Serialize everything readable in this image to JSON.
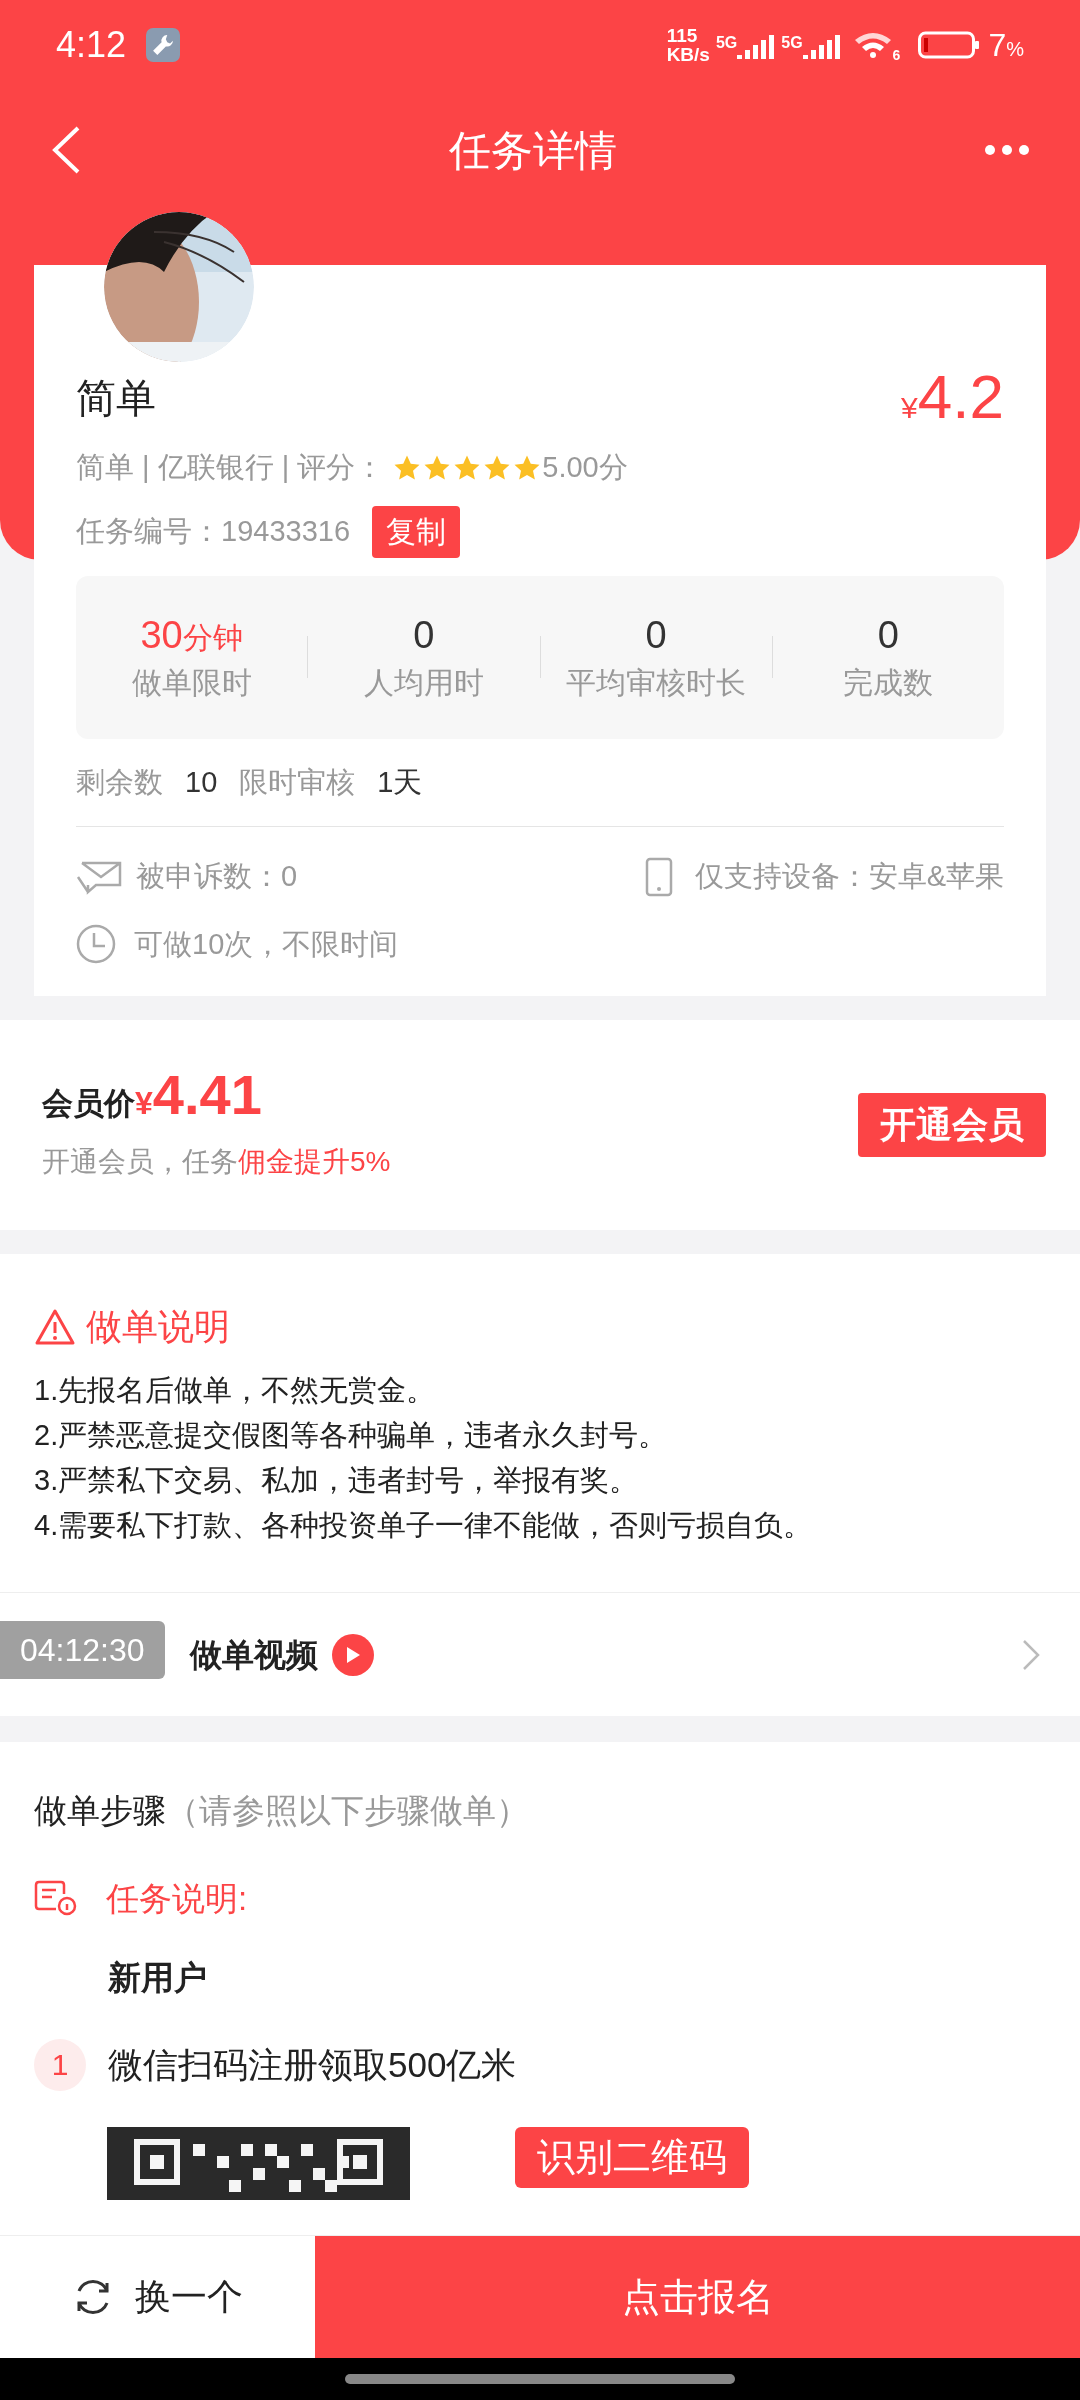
{
  "status_bar": {
    "time": "4:12",
    "net_speed": [
      "115",
      "KB/s"
    ],
    "sim_labels": [
      "5G",
      "5G"
    ],
    "wifi_badge": "6",
    "battery": "7",
    "battery_unit": "%"
  },
  "header": {
    "title": "任务详情"
  },
  "task": {
    "title": "简单",
    "price_symbol": "¥",
    "price": "4.2",
    "meta": "简单 | 亿联银行 | 评分：",
    "stars": 5,
    "rating": "5.00分",
    "id_label": "任务编号：",
    "id": "19433316",
    "copy_button": "复制",
    "stats": [
      {
        "value": "30",
        "unit": "分钟",
        "label": "做单限时",
        "highlight": true
      },
      {
        "value": "0",
        "label": "人均用时",
        "highlight": false
      },
      {
        "value": "0",
        "label": "平均审核时长",
        "highlight": false
      },
      {
        "value": "0",
        "label": "完成数",
        "highlight": false
      }
    ],
    "remaining_label": "剩余数",
    "remaining": "10",
    "review_label": "限时审核",
    "review": "1天",
    "complaints": "被申诉数：0",
    "devices": "仅支持设备：安卓&苹果",
    "repeat": "可做10次，不限时间"
  },
  "member": {
    "label": "会员价",
    "price_symbol": "¥",
    "price": "4.41",
    "note": "开通会员，任务",
    "note_highlight": "佣金提升5%",
    "button": "开通会员"
  },
  "instructions": {
    "title": "做单说明",
    "lines": [
      "1.先报名后做单，不然无赏金。",
      "2.严禁恶意提交假图等各种骗单，违者永久封号。",
      "3.严禁私下交易、私加，违者封号，举报有奖。",
      "4.需要私下打款、各种投资单子一律不能做，否则亏损自负。"
    ]
  },
  "video": {
    "title": "做单视频",
    "timestamp": "04:12:30"
  },
  "steps": {
    "title": "做单步骤",
    "hint": "（请参照以下步骤做单）",
    "task_label": "任务说明:",
    "task_text": "新用户",
    "items": [
      {
        "number": "1",
        "text": "微信扫码注册领取500亿米"
      }
    ],
    "qr_button": "识别二维码"
  },
  "bottom_bar": {
    "switch_button": "换一个",
    "apply_button": "点击报名"
  }
}
